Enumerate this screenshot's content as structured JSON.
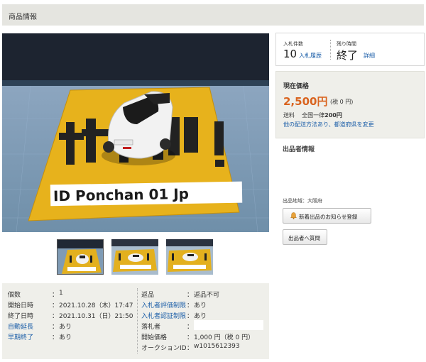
{
  "header": {
    "title": "商品情報"
  },
  "photo": {
    "sign_text": "ヤカゲ!",
    "caption": "ID Ponchan 01 Jp"
  },
  "thumbnails": [
    {
      "label": "thumbnail 1",
      "selected": true
    },
    {
      "label": "thumbnail 2",
      "selected": false
    },
    {
      "label": "thumbnail 3",
      "selected": false
    }
  ],
  "bid": {
    "count_label": "入札件数",
    "count_value": "10",
    "history_link": "入札履歴",
    "remaining_label": "残り時間",
    "remaining_value": "終了",
    "detail_link": "詳細"
  },
  "price": {
    "title": "現在価格",
    "value": "2,500円",
    "tax": "(税 0 円)",
    "shipping_label": "送料",
    "shipping_text": "全国一律",
    "shipping_value": "200円",
    "other_link": "他の配送方法あり、都道府県を変更",
    "accent": "#d9631e"
  },
  "seller": {
    "title": "出品者情報",
    "region": "出品地域：大阪府",
    "notify_button": "新着出品のお知らせ登録",
    "question_button": "出品者へ質問"
  },
  "specs_left": [
    {
      "key": "個数",
      "colon": "：",
      "value": "1",
      "key_link": false
    },
    {
      "key": "開始日時",
      "colon": "：",
      "value": "2021.10.28（木）17:47",
      "key_link": false
    },
    {
      "key": "終了日時",
      "colon": "：",
      "value": "2021.10.31（日）21:50",
      "key_link": false
    },
    {
      "key": "自動延長",
      "colon": "：",
      "value": "あり",
      "key_link": true
    },
    {
      "key": "早期終了",
      "colon": "：",
      "value": "あり",
      "key_link": true
    }
  ],
  "specs_right": [
    {
      "key": "返品",
      "colon": "：",
      "value": "返品不可",
      "key_link": false
    },
    {
      "key": "入札者評価制限",
      "colon": "：",
      "value": "あり",
      "key_link": true
    },
    {
      "key": "入札者認証制限",
      "colon": "：",
      "value": "あり",
      "key_link": true
    },
    {
      "key": "落札者",
      "colon": "：",
      "value": "",
      "key_link": false
    },
    {
      "key": "開始価格",
      "colon": "：",
      "value": "1,000 円（税 0 円）",
      "key_link": false
    },
    {
      "key": "オークションID",
      "colon": "：",
      "value": "w1015612393",
      "key_link": false
    }
  ]
}
